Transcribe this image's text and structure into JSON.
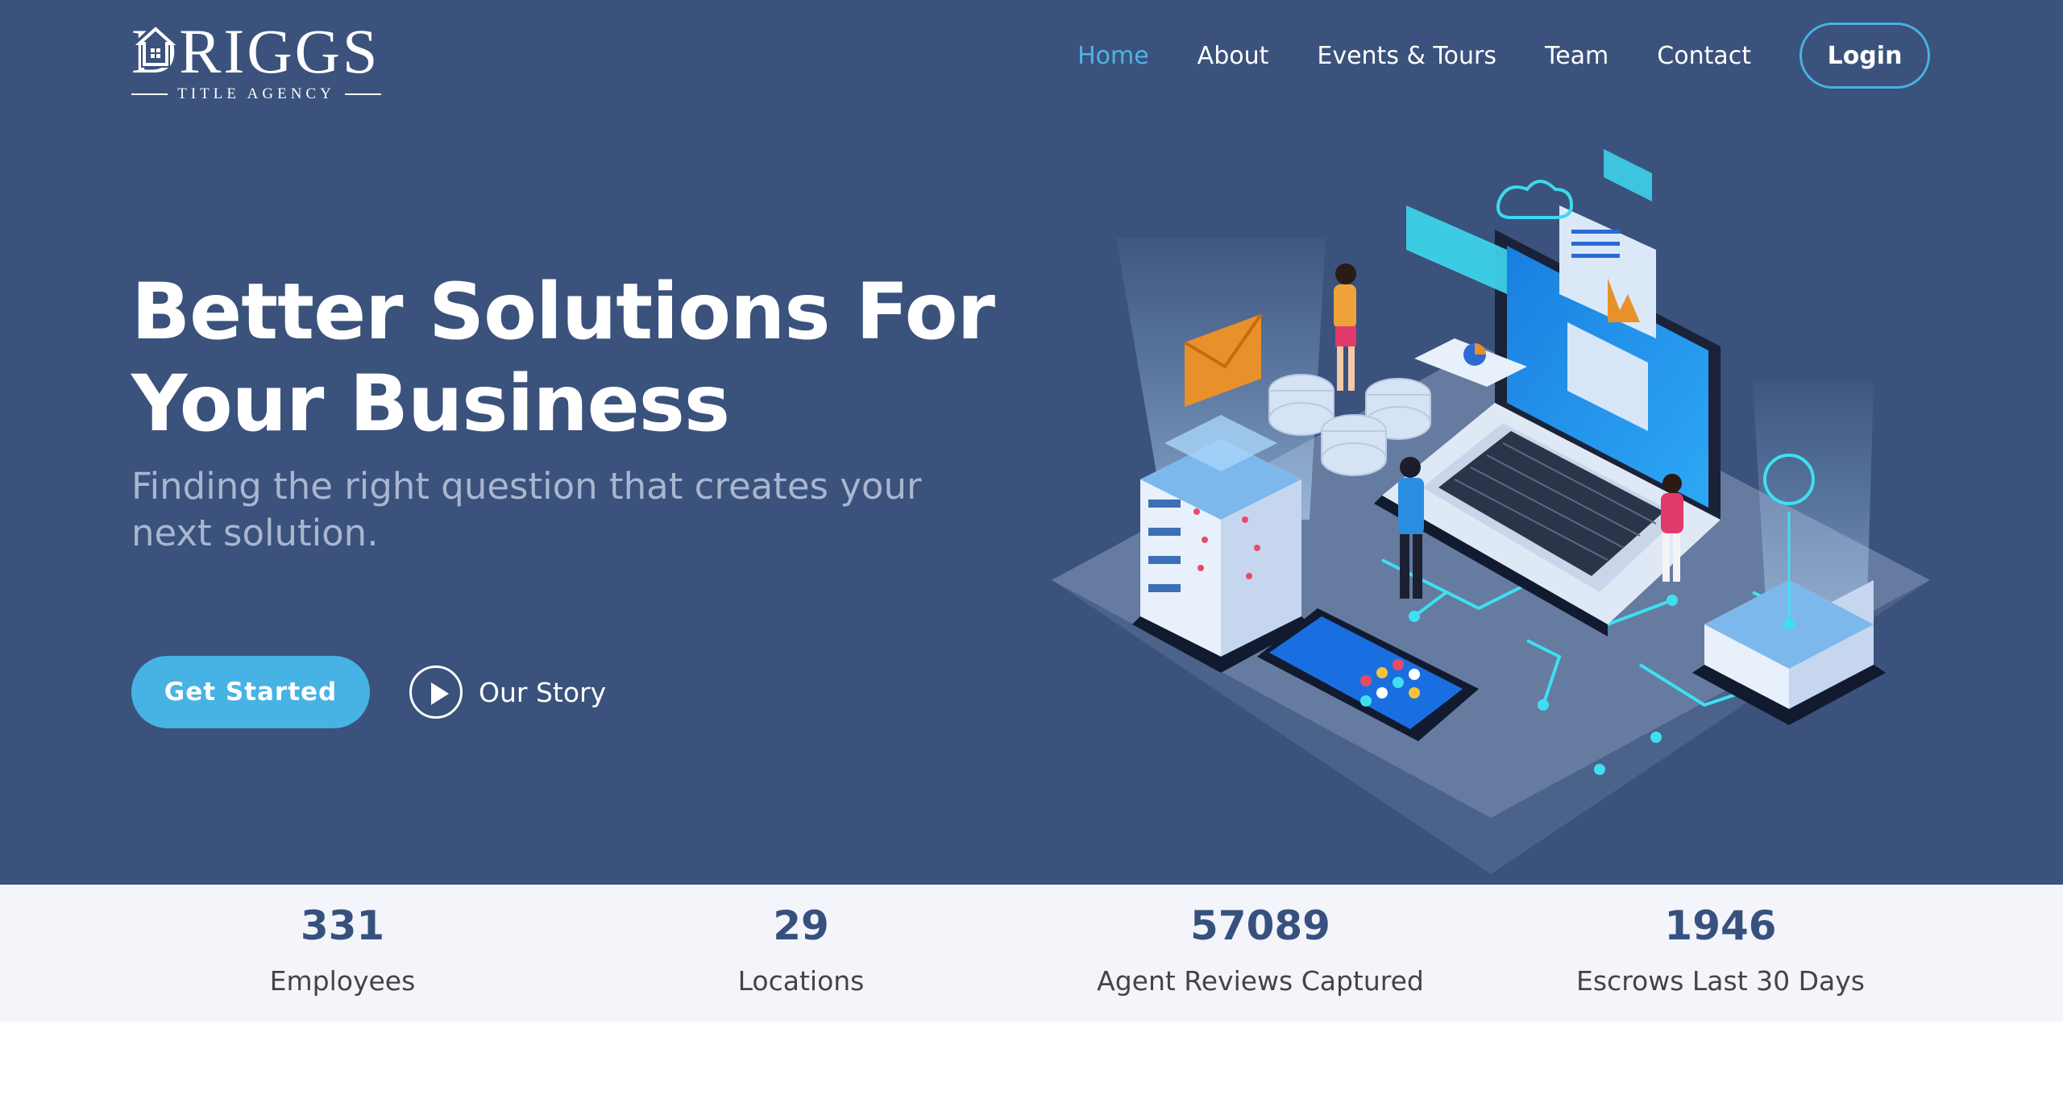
{
  "header": {
    "logo": {
      "name": "DRIGGS",
      "tagline": "TITLE AGENCY"
    },
    "nav": [
      "Home",
      "About",
      "Events & Tours",
      "Team",
      "Contact"
    ],
    "login": "Login"
  },
  "hero": {
    "title_line1": "Better Solutions For",
    "title_line2": "Your Business",
    "subtitle": "Finding the right question that creates your next solution.",
    "get_started": "Get Started",
    "our_story": "Our Story"
  },
  "stats": [
    {
      "value": "331",
      "label": "Employees"
    },
    {
      "value": "29",
      "label": "Locations"
    },
    {
      "value": "57089",
      "label": "Agent Reviews Captured"
    },
    {
      "value": "1946",
      "label": "Escrows Last 30 Days"
    }
  ],
  "colors": {
    "hero_bg": "#3a527c",
    "accent": "#47b2e4",
    "stat_number": "#37517e",
    "stats_bg": "#f3f5fa"
  }
}
